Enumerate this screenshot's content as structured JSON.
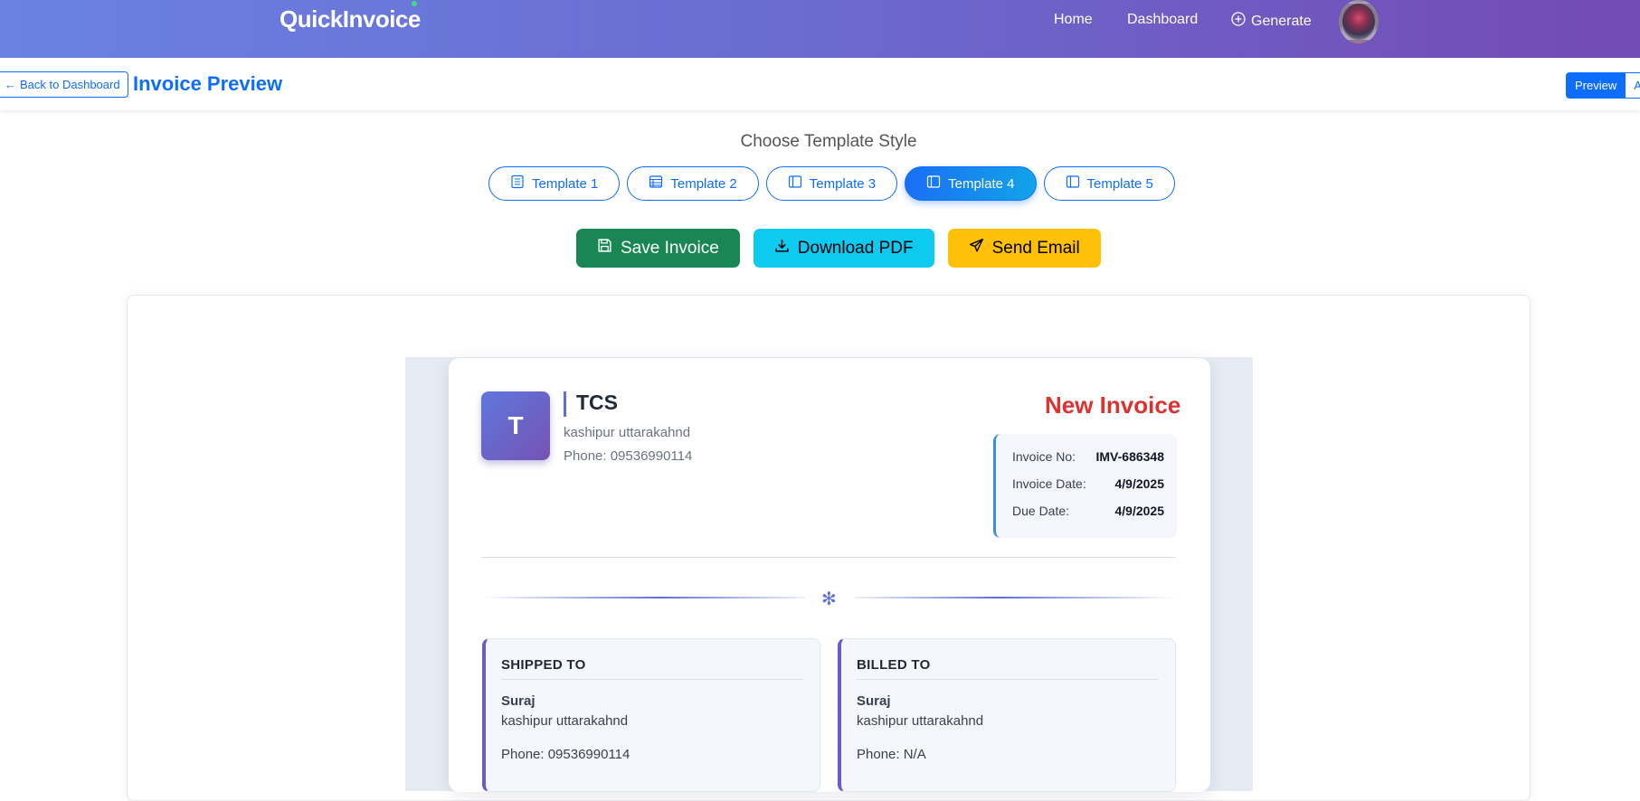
{
  "navbar": {
    "brand": "QuickInvoice",
    "links": {
      "home": "Home",
      "dashboard": "Dashboard",
      "generate": "Generate"
    },
    "gradient": [
      "#6a82e2",
      "#744ab3"
    ]
  },
  "subheader": {
    "back_label": "Back to Dashboard",
    "title": "Invoice Preview",
    "view_toggle": {
      "preview": "Preview",
      "actions": "Ac"
    }
  },
  "templates": {
    "heading": "Choose Template Style",
    "items": [
      "Template 1",
      "Template 2",
      "Template 3",
      "Template 4",
      "Template 5"
    ],
    "active": "Template 4"
  },
  "actions": {
    "save": "Save Invoice",
    "download": "Download PDF",
    "email": "Send Email",
    "colors": {
      "save": "#198754",
      "download": "#0dcaf0",
      "email": "#ffc107"
    }
  },
  "invoice": {
    "logo_letter": "T",
    "company": {
      "name": "TCS",
      "address": "kashipur uttarakahnd",
      "phone": "Phone: 09536990114"
    },
    "title": "New Invoice",
    "title_color": "#e03131",
    "meta": {
      "number_label": "Invoice No:",
      "number": "IMV-686348",
      "date_label": "Invoice Date:",
      "date": "4/9/2025",
      "due_label": "Due Date:",
      "due": "4/9/2025"
    },
    "shipped_to": {
      "heading": "SHIPPED TO",
      "name": "Suraj",
      "address": "kashipur uttarakahnd",
      "phone": "Phone: 09536990114"
    },
    "billed_to": {
      "heading": "BILLED TO",
      "name": "Suraj",
      "address": "kashipur uttarakahnd",
      "phone": "Phone: N/A"
    }
  }
}
